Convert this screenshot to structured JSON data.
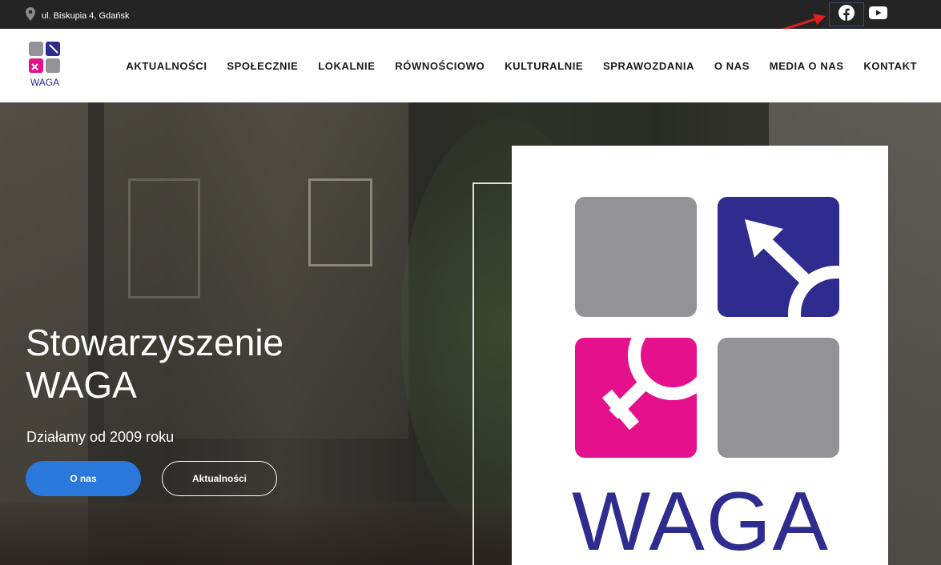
{
  "topbar": {
    "address": "ul. Biskupia 4, Gdańsk",
    "icons": {
      "location": "map-pin-icon",
      "facebook": "facebook-icon",
      "youtube": "youtube-icon"
    }
  },
  "header": {
    "logo_text": "WAGA",
    "nav": [
      "AKTUALNOŚCI",
      "SPOŁECZNIE",
      "LOKALNIE",
      "RÓWNOŚCIOWO",
      "KULTURALNIE",
      "SPRAWOZDANIA",
      "O NAS",
      "MEDIA O NAS",
      "KONTAKT"
    ]
  },
  "hero": {
    "title": "Stowarzyszenie WAGA",
    "subtitle": "Działamy od 2009 roku",
    "primary_button": "O nas",
    "secondary_button": "Aktualności",
    "logo_word": "WAGA"
  },
  "colors": {
    "primary_button": "#2a78dc",
    "logo_blue": "#2e2d8f",
    "logo_magenta": "#e5108c",
    "logo_gray": "#939397",
    "annotation_arrow": "#e02020"
  }
}
